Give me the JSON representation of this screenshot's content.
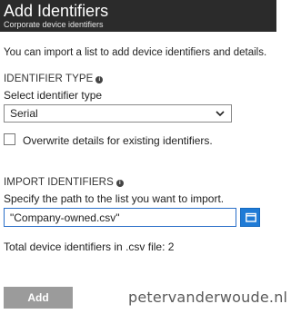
{
  "header": {
    "title": "Add Identifiers",
    "subtitle": "Corporate device identifiers"
  },
  "intro": "You can import a list to add device identifiers and details.",
  "identifier_type": {
    "section_label": "IDENTIFIER TYPE",
    "select_label": "Select identifier type",
    "selected": "Serial"
  },
  "overwrite": {
    "label": "Overwrite details for existing identifiers.",
    "checked": false
  },
  "import": {
    "section_label": "IMPORT IDENTIFIERS",
    "hint": "Specify the path to the list you want to import.",
    "file_value": "\"Company-owned.csv\"",
    "total_text": "Total device identifiers in .csv file: 2"
  },
  "actions": {
    "add_label": "Add"
  },
  "watermark": "petervanderwoude.nl",
  "icons": {
    "info": "info-icon",
    "dropdown": "chevron-down-icon",
    "browse": "folder-icon"
  },
  "colors": {
    "header_bg": "#2b2b2b",
    "accent": "#1f7bd6",
    "button_bg": "#9b9b9b"
  }
}
